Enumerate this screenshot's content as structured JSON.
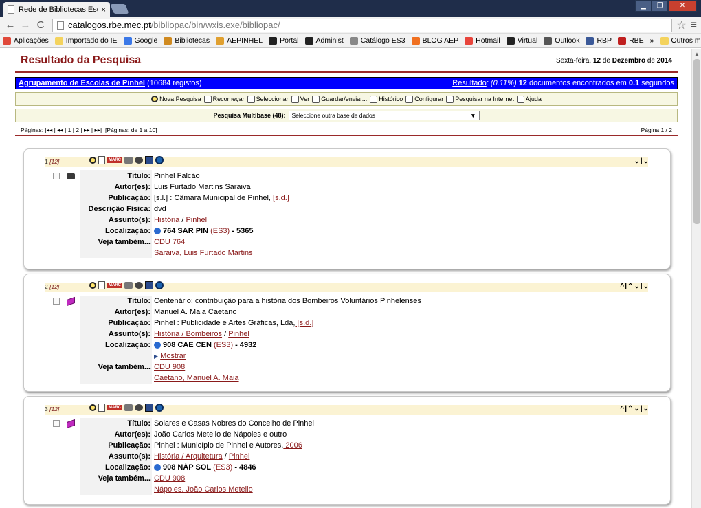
{
  "browser": {
    "tab_title": "Rede de Bibliotecas Escola",
    "tab_close": "×",
    "url_host": "catalogos.rbe.mec.pt",
    "url_path": "/bibliopac/bin/wxis.exe/bibliopac/",
    "star": "☆",
    "menu": "≡",
    "back": "←",
    "forward": "→",
    "reload": "C",
    "win_min": "▁",
    "win_max": "❐",
    "win_close": "✕"
  },
  "bookmarks": [
    {
      "label": "Aplicações",
      "color": "#e0493a"
    },
    {
      "label": "Importado do IE",
      "color": "#f4d35e"
    },
    {
      "label": "Google",
      "color": "#3b78e7"
    },
    {
      "label": "Bibliotecas",
      "color": "#d08a20"
    },
    {
      "label": "AEPINHEL",
      "color": "#e0a030"
    },
    {
      "label": "Portal",
      "color": "#222222"
    },
    {
      "label": "Administ",
      "color": "#222222"
    },
    {
      "label": "Catálogo ES3",
      "color": "#888888"
    },
    {
      "label": "BLOG AEP",
      "color": "#f07020"
    },
    {
      "label": "Hotmail",
      "color": "#e8453c"
    },
    {
      "label": "Virtual",
      "color": "#222222"
    },
    {
      "label": "Outlook",
      "color": "#555555"
    },
    {
      "label": "RBP",
      "color": "#3b5998"
    },
    {
      "label": "RBE",
      "color": "#c02020"
    },
    {
      "label": "»",
      "color": ""
    },
    {
      "label": "Outros marcadores",
      "color": "#f4d35e"
    }
  ],
  "header": {
    "title": "Resultado da Pesquisa",
    "date_weekday": "Sexta-feira,",
    "date_day": "12",
    "date_de1": "de",
    "date_month": "Dezembro",
    "date_de2": "de",
    "date_year": "2014"
  },
  "bluebar": {
    "collection": "Agrupamento de Escolas de Pinhel",
    "records_count": "(10684",
    "records_word": "registos)",
    "result_label": "Resultado",
    "result_pct": ": (0.11%)",
    "found_count": "12",
    "found_text": "documentos encontrados em",
    "seconds_value": "0.1",
    "seconds_word": "segundos"
  },
  "actions": [
    {
      "label": "Nova Pesquisa",
      "icon": "search-icon"
    },
    {
      "label": "Recomeçar",
      "icon": "home-icon"
    },
    {
      "label": "Seleccionar",
      "icon": "checklist-icon"
    },
    {
      "label": "Ver",
      "icon": "view-icon"
    },
    {
      "label": "Guardar/enviar...",
      "icon": "save-icon"
    },
    {
      "label": "Histórico",
      "icon": "history-icon"
    },
    {
      "label": "Configurar",
      "icon": "tools-icon"
    },
    {
      "label": "Pesquisar na Internet",
      "icon": "globe-icon"
    },
    {
      "label": "Ajuda",
      "icon": "help-icon"
    }
  ],
  "multibase": {
    "label": "Pesquisa Multibase (48):",
    "select_value": "Seleccione outra base de dados",
    "arrow": "▼"
  },
  "pager": {
    "pages_label": "Páginas:",
    "nav_first": "|◂◂",
    "nav_prev": "◂◂",
    "page1": "1",
    "page2": "2",
    "nav_next": "▸▸",
    "nav_last": "▸▸|",
    "pages_range": "[Páginas: de 1 a 10]",
    "page_of": "Página 1 / 2"
  },
  "labels": {
    "titulo": "Título:",
    "autor": "Autor(es):",
    "publicacao": "Publicação:",
    "descricao": "Descrição Física:",
    "assunto": "Assunto(s):",
    "localizacao": "Localização:",
    "veja": "Veja também...",
    "mostrar": "Mostrar",
    "marc": "MARC"
  },
  "records": [
    {
      "num": "1",
      "total": "[12]",
      "nav": "⌄|⌄",
      "material": "dvd",
      "titulo": "Pinhel Falcão",
      "autor": "Luis Furtado Martins Saraiva",
      "publicacao_text": "[s.l.] : Câmara Municipal de Pinhel,",
      "publicacao_link": " [s.d.]",
      "descricao": "dvd",
      "assunto": [
        "História",
        " / ",
        "Pinhel"
      ],
      "loc_code": "764 SAR PIN",
      "loc_lib": "(ES3)",
      "loc_num": "- 5365",
      "veja": [
        "CDU 764",
        "Saraiva, Luis Furtado Martins"
      ]
    },
    {
      "num": "2",
      "total": "[12]",
      "nav": "^|⌃⌄|⌄",
      "material": "book",
      "titulo": "Centenário: contribuição para a história dos Bombeiros Voluntários Pinhelenses",
      "autor": "Manuel A. Maia Caetano",
      "publicacao_text": "Pinhel : Publicidade e Artes Gráficas, Lda,",
      "publicacao_link": " [s.d.]",
      "assunto": [
        "História",
        " / Bombeiros",
        " / ",
        "Pinhel"
      ],
      "loc_code": "908 CAE CEN",
      "loc_lib": "(ES3)",
      "loc_num": "- 4932",
      "veja": [
        "CDU 908",
        "Caetano, Manuel A. Maia"
      ]
    },
    {
      "num": "3",
      "total": "[12]",
      "nav": "^|⌃⌄|⌄",
      "material": "book",
      "titulo": "Solares e Casas Nobres do Concelho de Pinhel",
      "autor": "João Carlos Metello de Nápoles e outro",
      "publicacao_text": "Pinhel : Município de Pinhel e Autores,",
      "publicacao_link": " 2006",
      "assunto": [
        "História",
        " / Arquitetura",
        " / ",
        "Pinhel"
      ],
      "loc_code": "908 NÁP SOL",
      "loc_lib": "(ES3)",
      "loc_num": "- 4846",
      "veja": [
        "CDU 908",
        "Nápoles, João Carlos Metello"
      ]
    }
  ]
}
